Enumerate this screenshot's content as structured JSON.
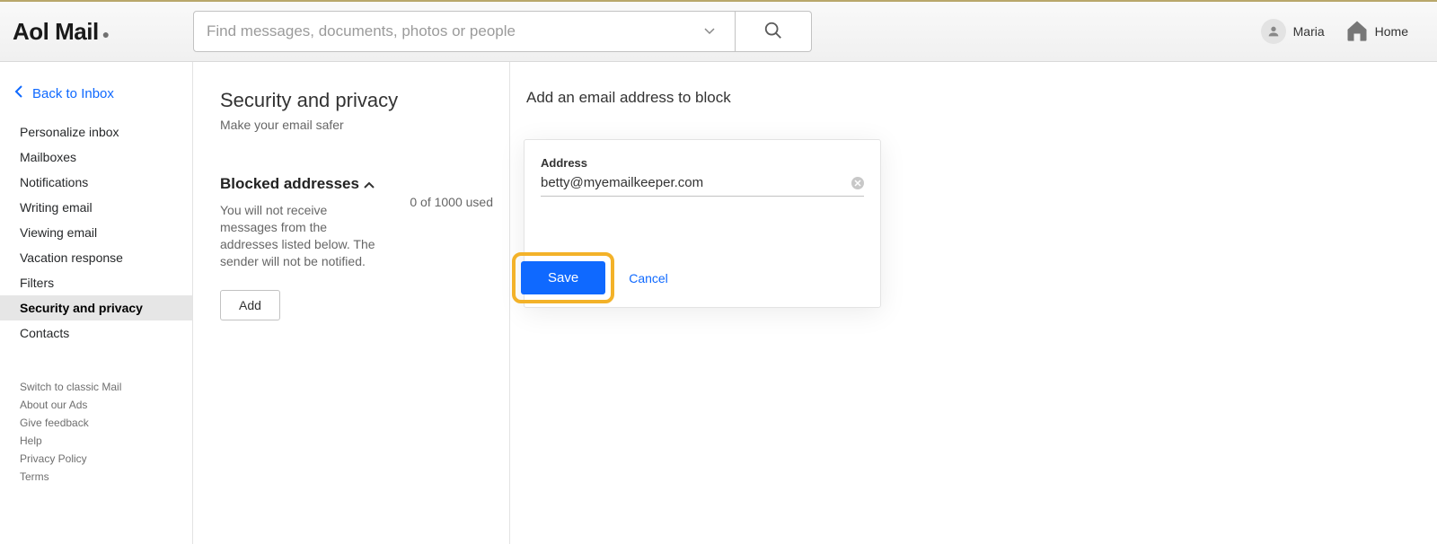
{
  "header": {
    "logo_text": "Aol Mail",
    "logo_dot": "●",
    "search_placeholder": "Find messages, documents, photos or people",
    "user_name": "Maria",
    "home_label": "Home"
  },
  "sidebar": {
    "back_label": "Back to Inbox",
    "items": [
      {
        "label": "Personalize inbox"
      },
      {
        "label": "Mailboxes"
      },
      {
        "label": "Notifications"
      },
      {
        "label": "Writing email"
      },
      {
        "label": "Viewing email"
      },
      {
        "label": "Vacation response"
      },
      {
        "label": "Filters"
      },
      {
        "label": "Security and privacy"
      },
      {
        "label": "Contacts"
      }
    ],
    "footer": [
      {
        "label": "Switch to classic Mail"
      },
      {
        "label": "About our Ads"
      },
      {
        "label": "Give feedback"
      },
      {
        "label": "Help"
      },
      {
        "label": "Privacy Policy"
      },
      {
        "label": "Terms"
      }
    ]
  },
  "mid": {
    "title": "Security and privacy",
    "subtitle": "Make your email safer",
    "blocked_title": "Blocked addresses",
    "blocked_desc": "You will not receive messages from the addresses listed below. The sender will not be notified.",
    "blocked_count": "0 of 1000 used",
    "add_label": "Add"
  },
  "right": {
    "title": "Add an email address to block",
    "card_label": "Address",
    "card_value": "betty@myemailkeeper.com",
    "save_label": "Save",
    "cancel_label": "Cancel"
  }
}
